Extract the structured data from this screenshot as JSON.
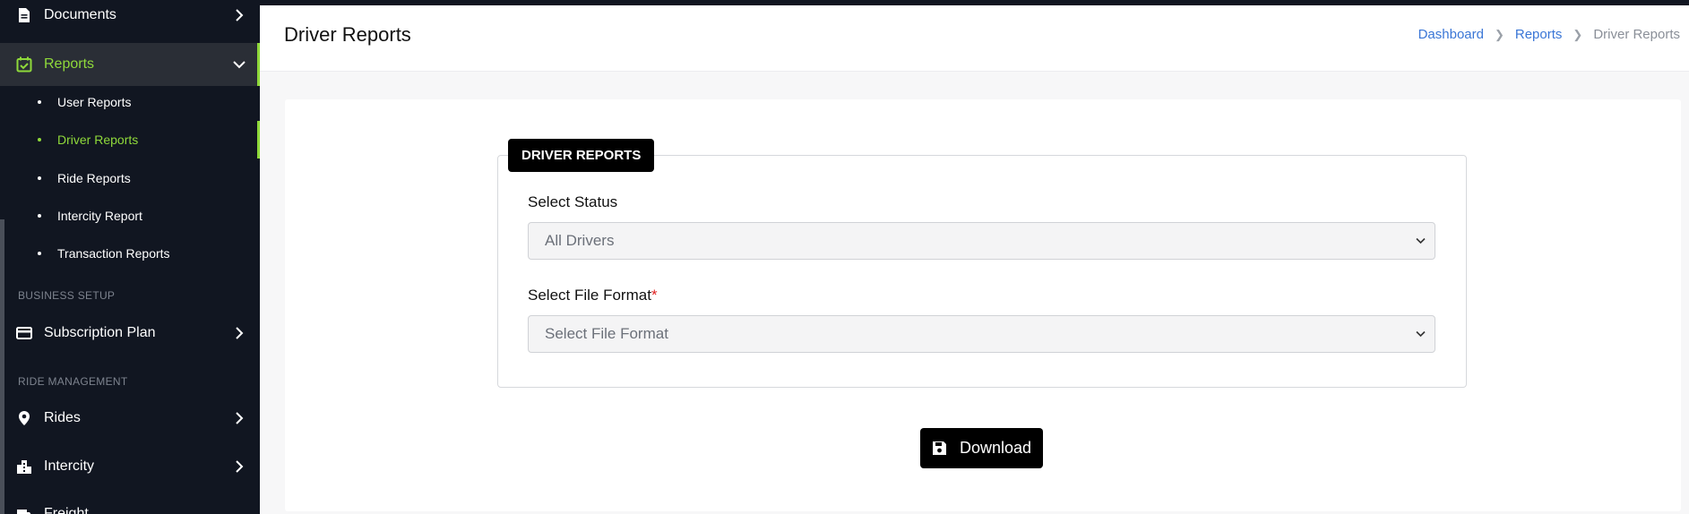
{
  "sidebar": {
    "items": {
      "documents": {
        "label": "Documents",
        "icon": "document-icon"
      },
      "reports": {
        "label": "Reports",
        "icon": "calendar-check-icon"
      },
      "subscription": {
        "label": "Subscription Plan",
        "icon": "credit-card-icon"
      },
      "rides": {
        "label": "Rides",
        "icon": "location-pin-icon"
      },
      "intercity": {
        "label": "Intercity",
        "icon": "buildings-icon"
      },
      "freight": {
        "label": "Freight",
        "icon": "truck-icon"
      }
    },
    "report_subitems": [
      {
        "label": "User Reports"
      },
      {
        "label": "Driver Reports"
      },
      {
        "label": "Ride Reports"
      },
      {
        "label": "Intercity Report"
      },
      {
        "label": "Transaction Reports"
      }
    ],
    "sections": {
      "business_setup": "BUSINESS SETUP",
      "ride_management": "RIDE MANAGEMENT"
    }
  },
  "header": {
    "title": "Driver Reports",
    "breadcrumb": [
      "Dashboard",
      "Reports",
      "Driver Reports"
    ]
  },
  "form": {
    "legend": "DRIVER REPORTS",
    "status_label": "Select Status",
    "status_value": "All Drivers",
    "format_label": "Select File Format",
    "format_required_marker": "*",
    "format_placeholder": "Select File Format",
    "download_label": "Download"
  },
  "colors": {
    "sidebar_bg": "#111621",
    "accent_green": "#8fd93a",
    "link_blue": "#3a76d6",
    "required_red": "#e02424"
  }
}
